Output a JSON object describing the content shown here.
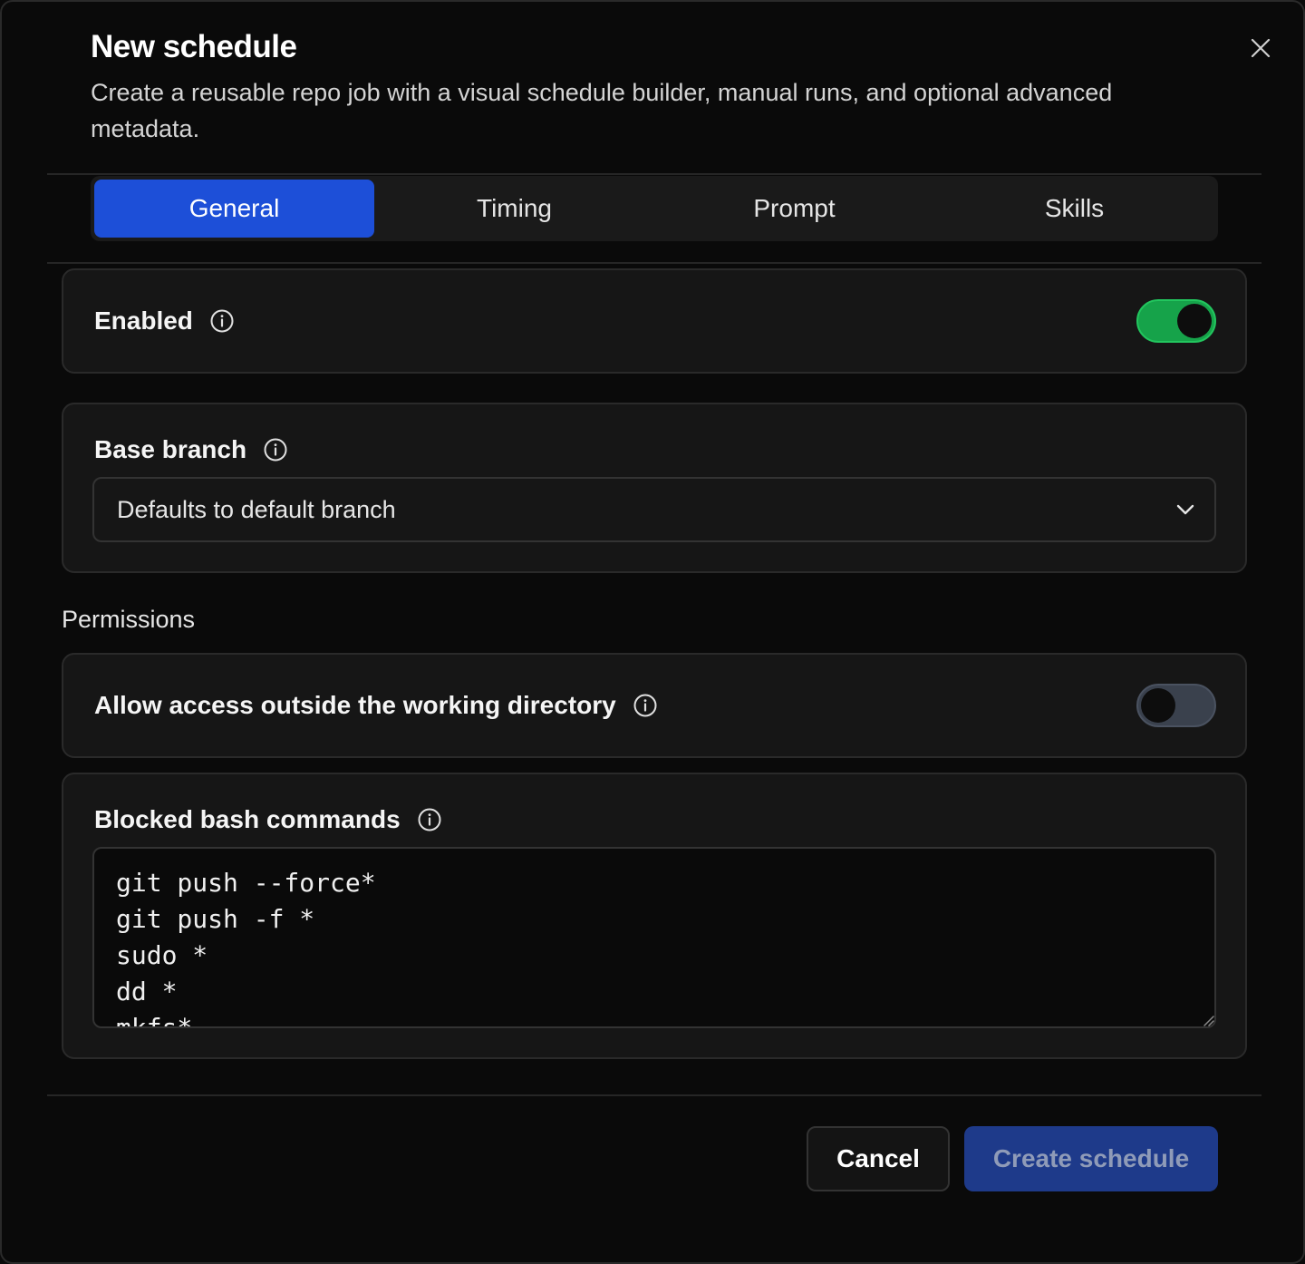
{
  "dialog": {
    "title": "New schedule",
    "description": "Create a reusable repo job with a visual schedule builder, manual runs, and optional advanced metadata.",
    "close_icon": "close-icon"
  },
  "tabs": [
    {
      "label": "General",
      "active": true
    },
    {
      "label": "Timing",
      "active": false
    },
    {
      "label": "Prompt",
      "active": false
    },
    {
      "label": "Skills",
      "active": false
    }
  ],
  "enabled": {
    "label": "Enabled",
    "value": true
  },
  "base_branch": {
    "label": "Base branch",
    "placeholder": "Defaults to default branch"
  },
  "permissions": {
    "section_label": "Permissions",
    "allow_outside": {
      "label": "Allow access outside the working directory",
      "value": false
    },
    "blocked_commands": {
      "label": "Blocked bash commands",
      "value": "git push --force*\ngit push -f *\nsudo *\ndd *\nmkfs*"
    }
  },
  "footer": {
    "cancel_label": "Cancel",
    "create_label": "Create schedule"
  },
  "colors": {
    "accent": "#1d4fd8",
    "toggle_on": "#16a34a",
    "background": "#0a0a0a"
  }
}
